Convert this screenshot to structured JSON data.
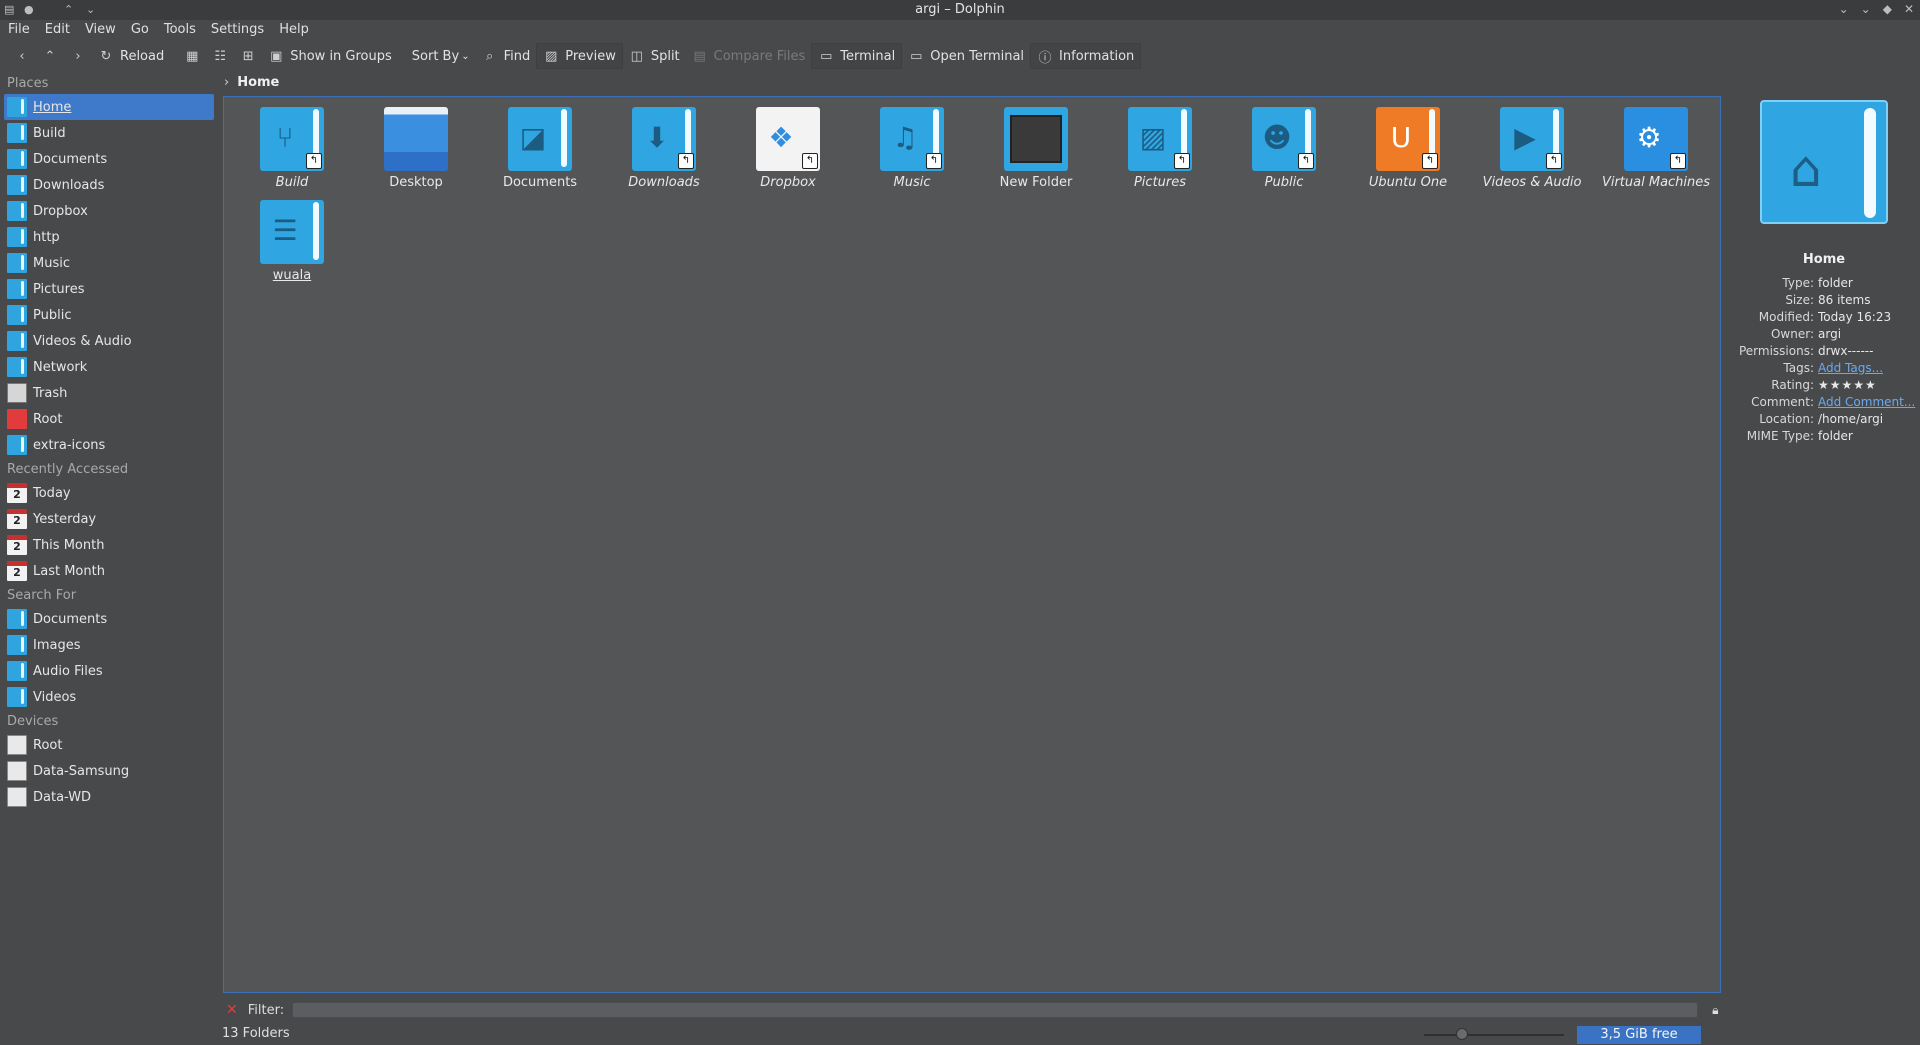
{
  "window": {
    "title": "argi – Dolphin"
  },
  "menubar": [
    "File",
    "Edit",
    "View",
    "Go",
    "Tools",
    "Settings",
    "Help"
  ],
  "toolbar": {
    "reload": "Reload",
    "show_in_groups": "Show in Groups",
    "sort_by": "Sort By",
    "find": "Find",
    "preview": "Preview",
    "split": "Split",
    "compare_files": "Compare Files",
    "terminal": "Terminal",
    "open_terminal": "Open Terminal",
    "information": "Information"
  },
  "sidebar": {
    "places_title": "Places",
    "places": [
      "Home",
      "Build",
      "Documents",
      "Downloads",
      "Dropbox",
      "http",
      "Music",
      "Pictures",
      "Public",
      "Videos & Audio",
      "Network",
      "Trash",
      "Root",
      "extra-icons"
    ],
    "recent_title": "Recently Accessed",
    "recent": [
      "Today",
      "Yesterday",
      "This Month",
      "Last Month"
    ],
    "calendar_day": "2",
    "search_title": "Search For",
    "search": [
      "Documents",
      "Images",
      "Audio Files",
      "Videos"
    ],
    "devices_title": "Devices",
    "devices": [
      "Root",
      "Data-Samsung",
      "Data-WD"
    ]
  },
  "breadcrumb": {
    "current": "Home"
  },
  "files": [
    "Build",
    "Desktop",
    "Documents",
    "Downloads",
    "Dropbox",
    "Music",
    "New Folder",
    "Pictures",
    "Public",
    "Ubuntu One",
    "Videos & Audio",
    "Virtual Machines",
    "wuala"
  ],
  "info": {
    "name": "Home",
    "rows": [
      {
        "k": "Type:",
        "v": "folder"
      },
      {
        "k": "Size:",
        "v": "86 items"
      },
      {
        "k": "Modified:",
        "v": "Today 16:23"
      },
      {
        "k": "Owner:",
        "v": "argi"
      },
      {
        "k": "Permissions:",
        "v": "drwx------"
      },
      {
        "k": "Tags:",
        "v": "Add Tags..."
      },
      {
        "k": "Rating:",
        "v": "★★★★★"
      },
      {
        "k": "Comment:",
        "v": "Add Comment..."
      },
      {
        "k": "Location:",
        "v": "/home/argi"
      },
      {
        "k": "MIME Type:",
        "v": "folder"
      }
    ]
  },
  "filter": {
    "label": "Filter:",
    "value": ""
  },
  "status": {
    "count": "13 Folders",
    "free": "3,5 GiB free"
  }
}
